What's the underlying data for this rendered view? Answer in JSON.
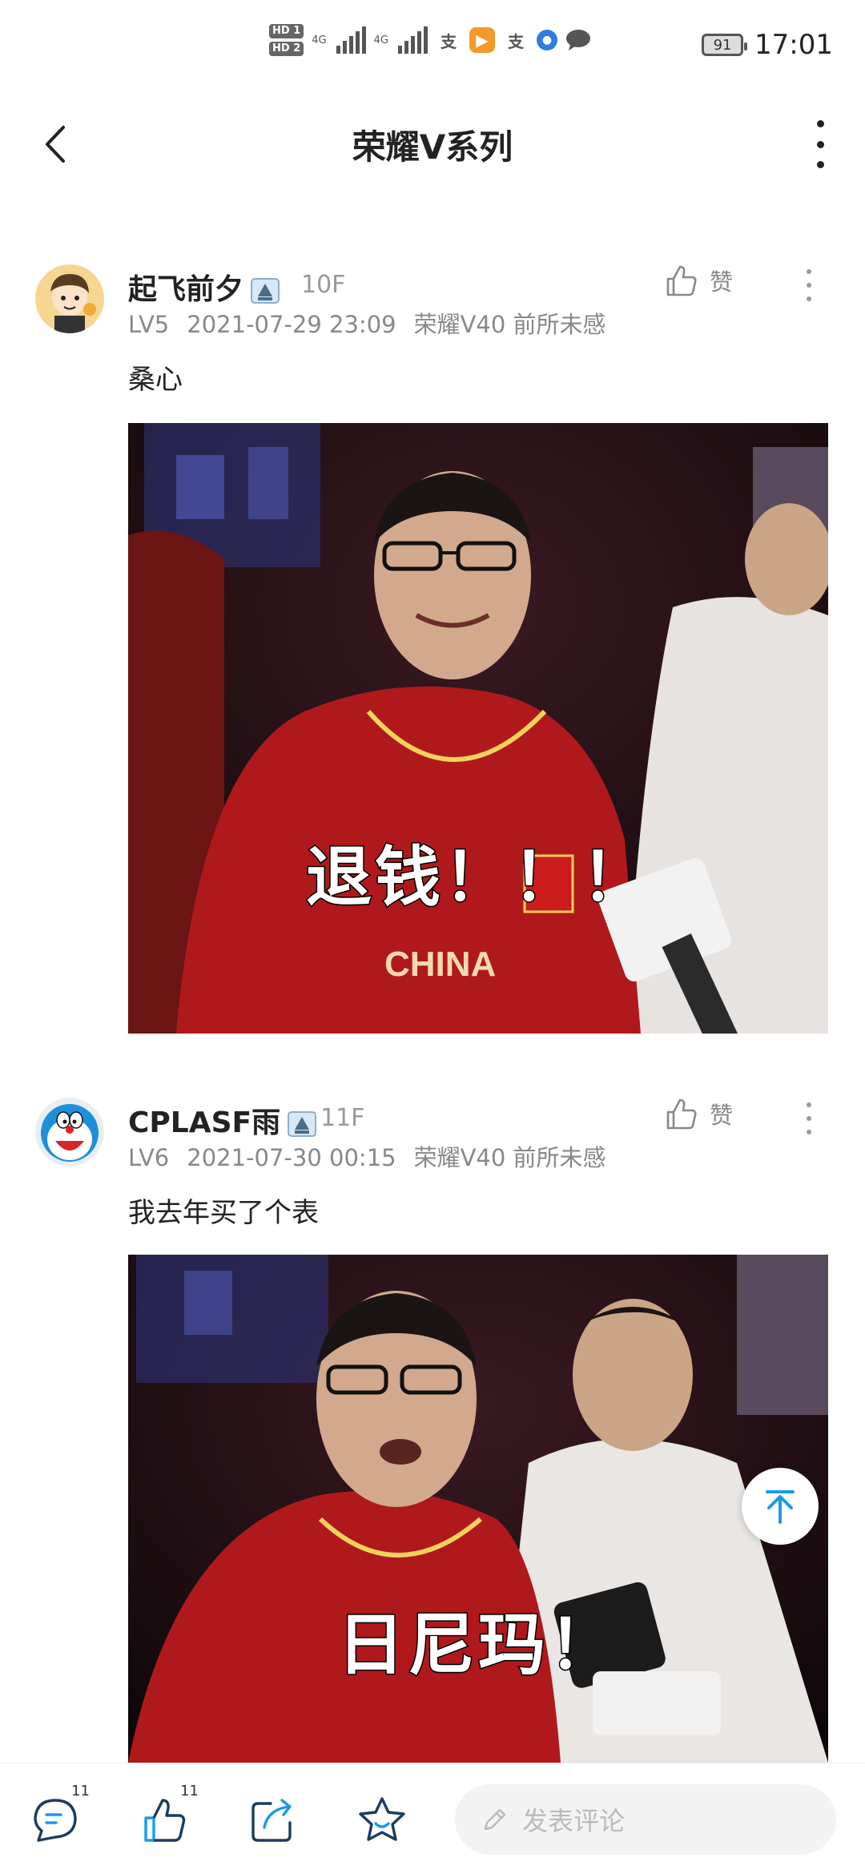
{
  "status_bar": {
    "hd1": "HD 1",
    "hd2": "HD 2",
    "network1": "4G",
    "network2": "4G",
    "battery": "91",
    "time": "17:01"
  },
  "header": {
    "title": "荣耀V系列"
  },
  "posts": [
    {
      "author": "起飞前夕",
      "floor": "10F",
      "level": "LV5",
      "datetime": "2021-07-29 23:09",
      "device": "荣耀V40 前所未感",
      "like_label": "赞",
      "text": "桑心",
      "image_caption": "退钱！！！"
    },
    {
      "author": "CPLASF雨",
      "floor": "11F",
      "level": "LV6",
      "datetime": "2021-07-30 00:15",
      "device": "荣耀V40 前所未感",
      "like_label": "赞",
      "text": "我去年买了个表",
      "image_caption": "日尼玛！"
    }
  ],
  "bottom_bar": {
    "comment_count": "11",
    "like_count": "11",
    "comment_placeholder": "发表评论"
  },
  "colors": {
    "accent": "#1a9be6",
    "text_primary": "#222222",
    "text_secondary": "#888888"
  }
}
